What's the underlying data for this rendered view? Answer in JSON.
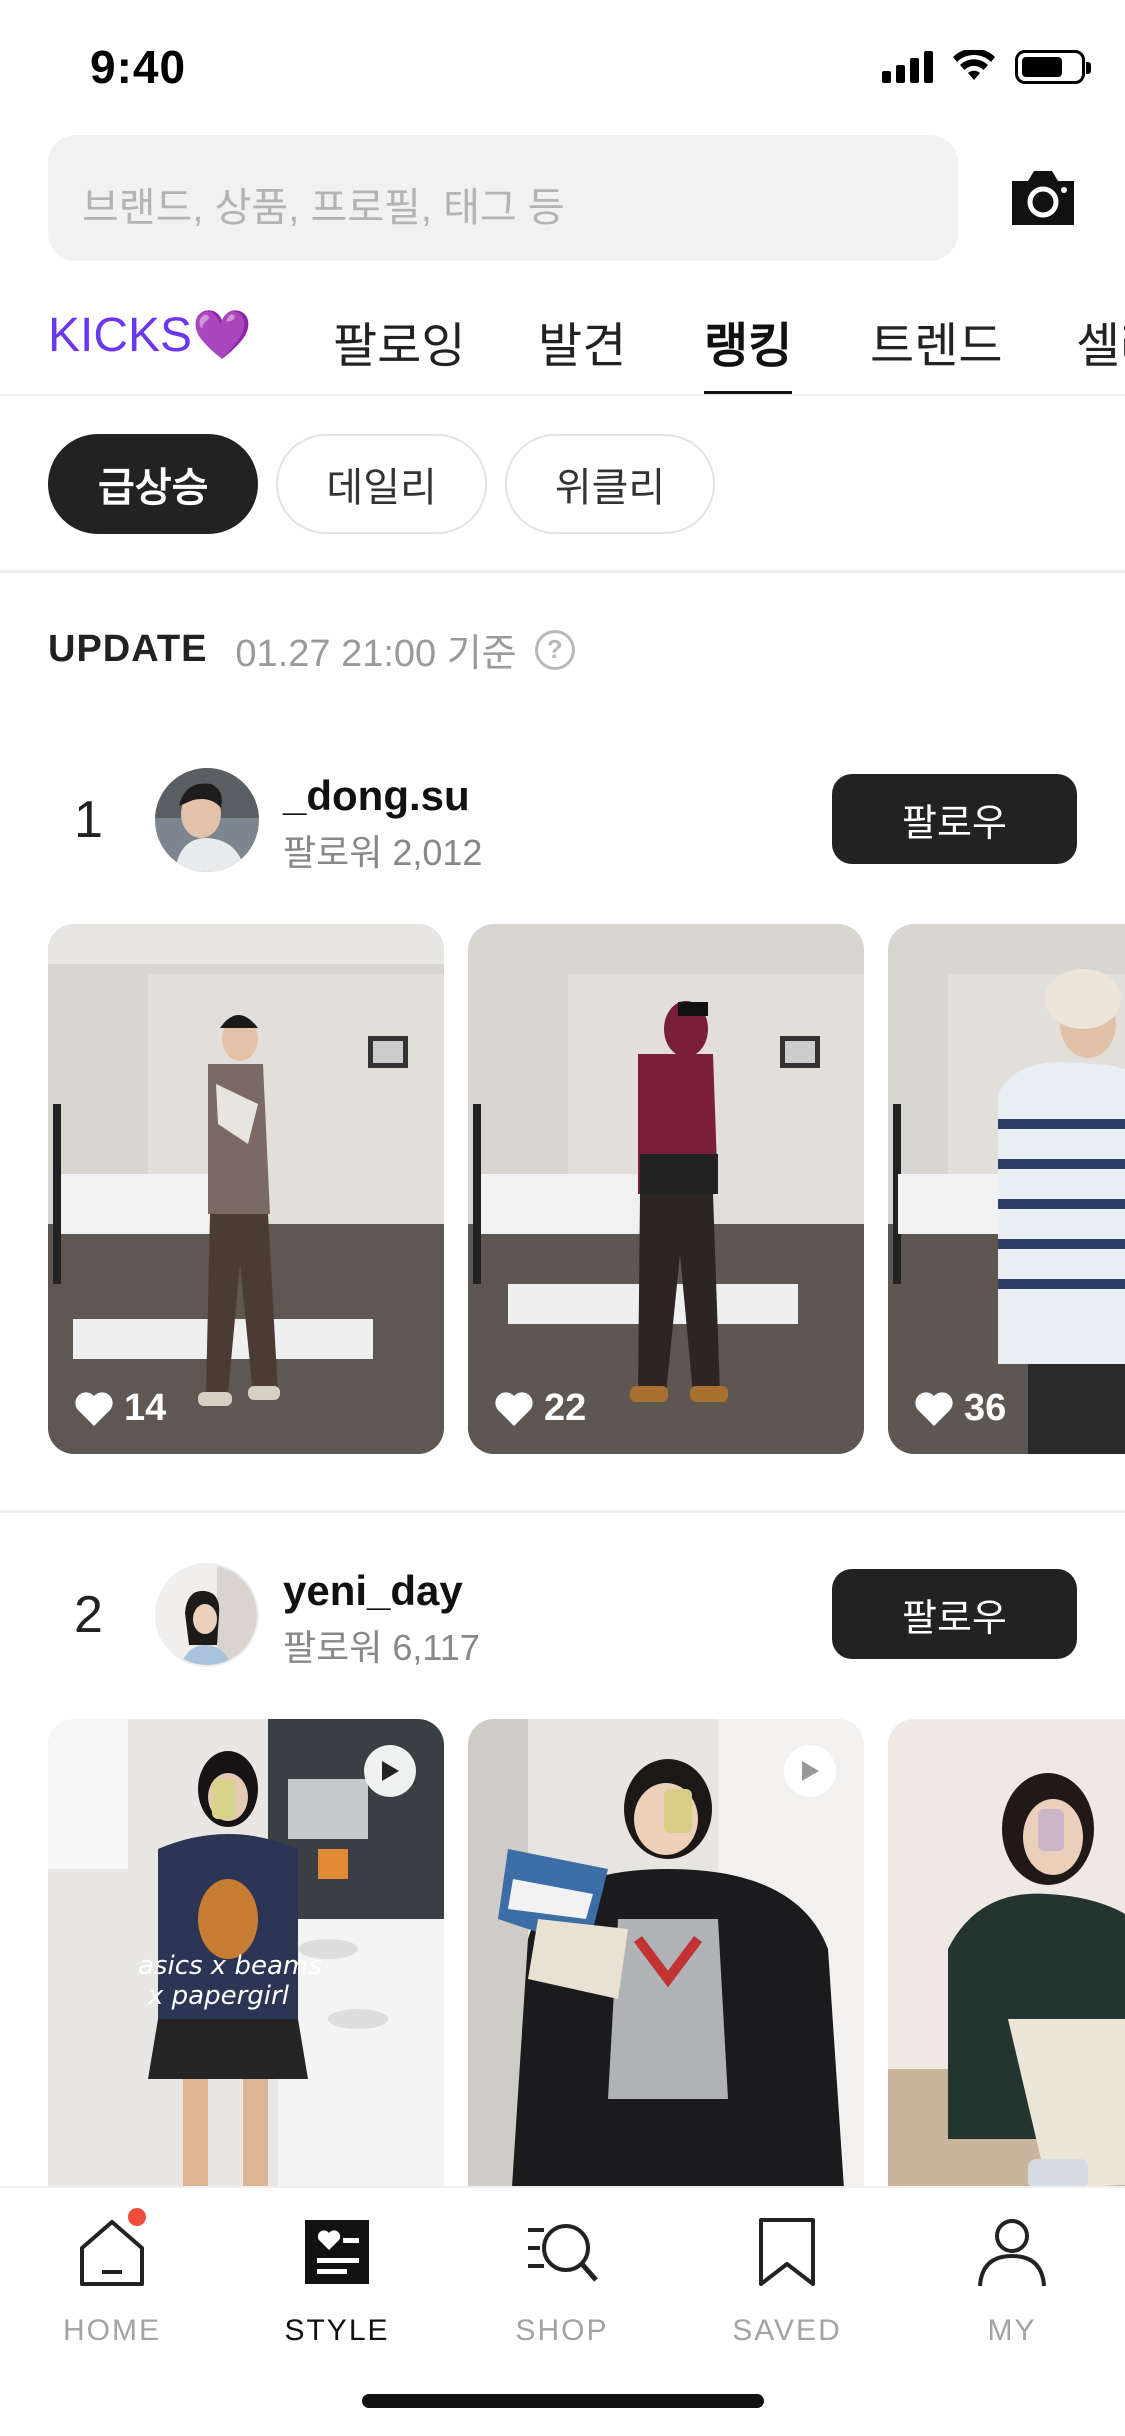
{
  "status_bar": {
    "time": "9:40"
  },
  "search": {
    "placeholder": "브랜드, 상품, 프로필, 태그 등",
    "camera_icon": "camera-icon"
  },
  "tabs": [
    {
      "label": "KICKS💜",
      "active": false
    },
    {
      "label": "팔로잉",
      "active": false
    },
    {
      "label": "발견",
      "active": false
    },
    {
      "label": "랭킹",
      "active": true
    },
    {
      "label": "트렌드",
      "active": false
    },
    {
      "label": "셀러",
      "active": false
    }
  ],
  "chips": [
    {
      "label": "급상승",
      "selected": true
    },
    {
      "label": "데일리",
      "selected": false
    },
    {
      "label": "위클리",
      "selected": false
    }
  ],
  "update": {
    "label": "UPDATE",
    "time": "01.27 21:00 기준",
    "info_icon": "?"
  },
  "rankings": [
    {
      "rank": "1",
      "username": "_dong.su",
      "followers": "팔로워 2,012",
      "follow_label": "팔로우",
      "photos": [
        {
          "likes": "14",
          "video": false
        },
        {
          "likes": "22",
          "video": false
        },
        {
          "likes": "36",
          "video": false
        }
      ]
    },
    {
      "rank": "2",
      "username": "yeni_day",
      "followers": "팔로워 6,117",
      "follow_label": "팔로우",
      "photos": [
        {
          "likes": "",
          "video": true,
          "overlay_text_1": "asics x beams",
          "overlay_text_2": "x papergirl"
        },
        {
          "likes": "",
          "video": true
        },
        {
          "likes": "",
          "video": false
        }
      ]
    }
  ],
  "bottom_nav": [
    {
      "label": "HOME",
      "icon": "home-icon",
      "active": false,
      "badge": true
    },
    {
      "label": "STYLE",
      "icon": "style-icon",
      "active": true,
      "badge": false
    },
    {
      "label": "SHOP",
      "icon": "shop-icon",
      "active": false,
      "badge": false
    },
    {
      "label": "SAVED",
      "icon": "bookmark-icon",
      "active": false,
      "badge": false
    },
    {
      "label": "MY",
      "icon": "person-icon",
      "active": false,
      "badge": false
    }
  ],
  "colors": {
    "accent": "#6b38f2",
    "dark": "#222222",
    "badge": "#f04b3c"
  }
}
